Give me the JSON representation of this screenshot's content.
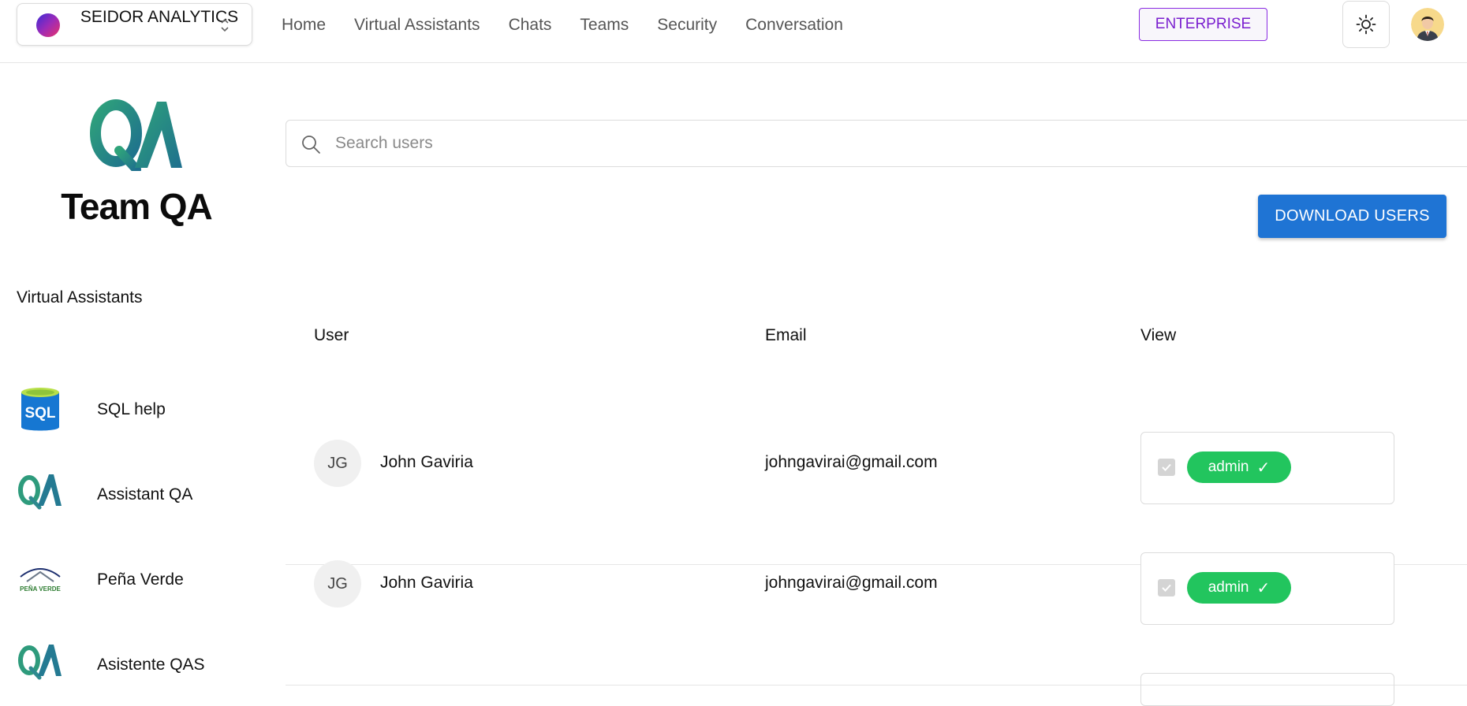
{
  "org": {
    "name": "SEIDOR ANALYTICS"
  },
  "nav": {
    "items": [
      "Home",
      "Virtual Assistants",
      "Chats",
      "Teams",
      "Security",
      "Conversation"
    ]
  },
  "header": {
    "enterprise_label": "ENTERPRISE"
  },
  "team": {
    "title": "Team QA"
  },
  "sidebar": {
    "heading": "Virtual Assistants",
    "items": [
      {
        "label": "SQL help",
        "icon": "sql-database-icon"
      },
      {
        "label": "Assistant QA",
        "icon": "qa-logo-icon"
      },
      {
        "label": "Peña Verde",
        "icon": "pena-verde-logo-icon"
      },
      {
        "label": "Asistente QAS",
        "icon": "qa-logo-icon"
      }
    ]
  },
  "search": {
    "placeholder": "Search users"
  },
  "actions": {
    "download_label": "DOWNLOAD USERS"
  },
  "table": {
    "headers": {
      "user": "User",
      "email": "Email",
      "view": "View"
    },
    "rows": [
      {
        "initials": "JG",
        "name": "John Gaviria",
        "email": "johngavirai@gmail.com",
        "role": "admin",
        "checked": true
      },
      {
        "initials": "JG",
        "name": "John Gaviria",
        "email": "johngavirai@gmail.com",
        "role": "admin",
        "checked": true
      }
    ]
  },
  "colors": {
    "accent_blue": "#1f74d4",
    "role_green": "#22c55e",
    "enterprise_purple": "#7a1fcf"
  }
}
